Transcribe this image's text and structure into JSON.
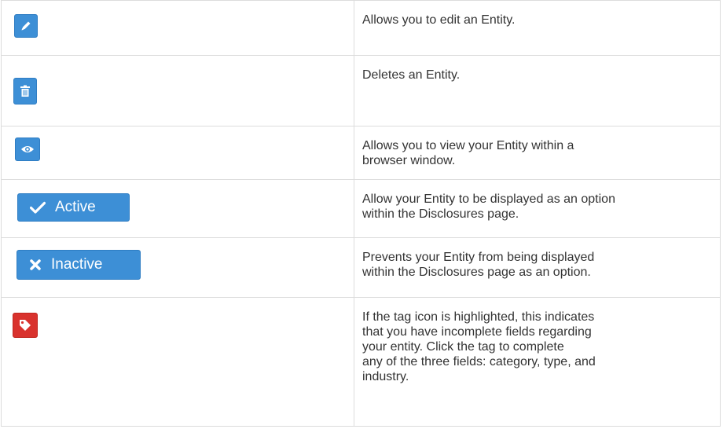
{
  "rows": [
    {
      "icon": "pencil-icon",
      "description": "Allows you to edit an Entity."
    },
    {
      "icon": "trash-icon",
      "description": "Deletes an Entity."
    },
    {
      "icon": "eye-icon",
      "description": "Allows you to view your Entity within a\nbrowser window."
    },
    {
      "icon": "check-icon",
      "button_label": "Active",
      "description": "Allow your Entity to be displayed as an option\nwithin the Disclosures page."
    },
    {
      "icon": "x-icon",
      "button_label": "Inactive",
      "description": "Prevents your Entity from being displayed\nwithin the Disclosures page as an option."
    },
    {
      "icon": "tag-icon",
      "description": "If the tag icon is highlighted, this indicates\nthat you have incomplete fields regarding\nyour entity. Click the tag to complete\nany of the three fields: category, type, and\nindustry."
    }
  ],
  "colors": {
    "button_blue": "#3d8fd6",
    "tag_red": "#d9322d",
    "border": "#dcdcdc"
  }
}
